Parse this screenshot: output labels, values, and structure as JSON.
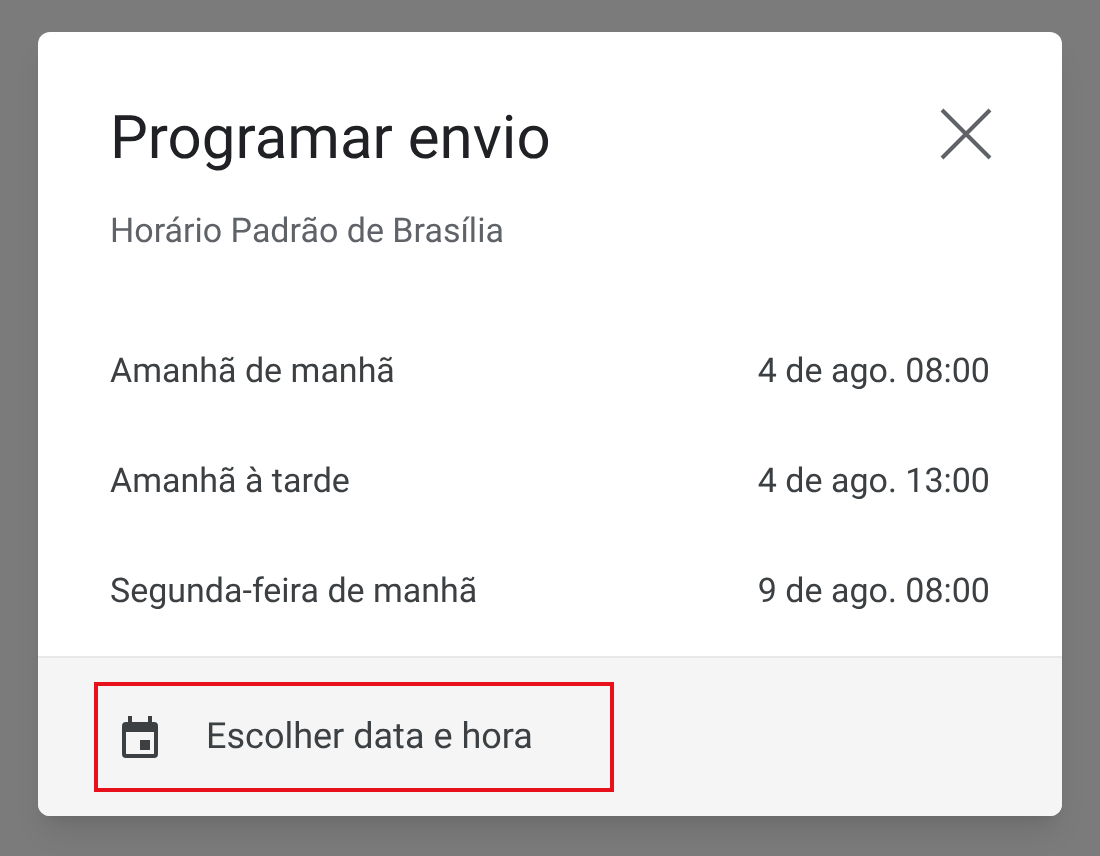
{
  "dialog": {
    "title": "Programar envio",
    "subtitle": "Horário Padrão de Brasília"
  },
  "options": [
    {
      "label": "Amanhã de manhã",
      "time": "4 de ago. 08:00"
    },
    {
      "label": "Amanhã à tarde",
      "time": "4 de ago. 13:00"
    },
    {
      "label": "Segunda-feira de manhã",
      "time": "9 de ago. 08:00"
    }
  ],
  "footer": {
    "label": "Escolher data e hora",
    "highlighted": true
  }
}
